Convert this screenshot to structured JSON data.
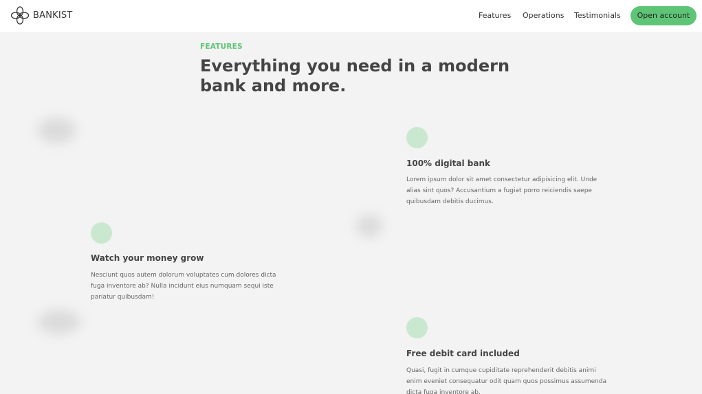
{
  "nav": {
    "brand": "BANKIST",
    "links": [
      "Features",
      "Operations",
      "Testimonials"
    ],
    "cta": "Open account"
  },
  "section": {
    "eyebrow": "FEATURES",
    "headline": "Everything you need in a modern bank and more."
  },
  "features": [
    {
      "icon": "feature-icon",
      "title": "100% digital bank",
      "text": "Lorem ipsum dolor sit amet consectetur adipisicing elit. Unde alias sint quos? Accusantium a fugiat porro reiciendis saepe quibusdam debitis ducimus."
    },
    {
      "icon": "feature-icon",
      "title": "Watch your money grow",
      "text": "Nesciunt quos autem dolorum voluptates cum dolores dicta fuga inventore ab? Nulla incidunt eius numquam sequi iste pariatur quibusdam!"
    },
    {
      "icon": "feature-icon",
      "title": "Free debit card included",
      "text": "Quasi, fugit in cumque cupiditate reprehenderit debitis animi enim eveniet consequatur odit quam quos possimus assumenda dicta fuga inventore ab."
    }
  ],
  "colors": {
    "accent": "#5ec576",
    "icon_circle": "#c9e8cf",
    "page_bg": "#f3f3f3"
  }
}
